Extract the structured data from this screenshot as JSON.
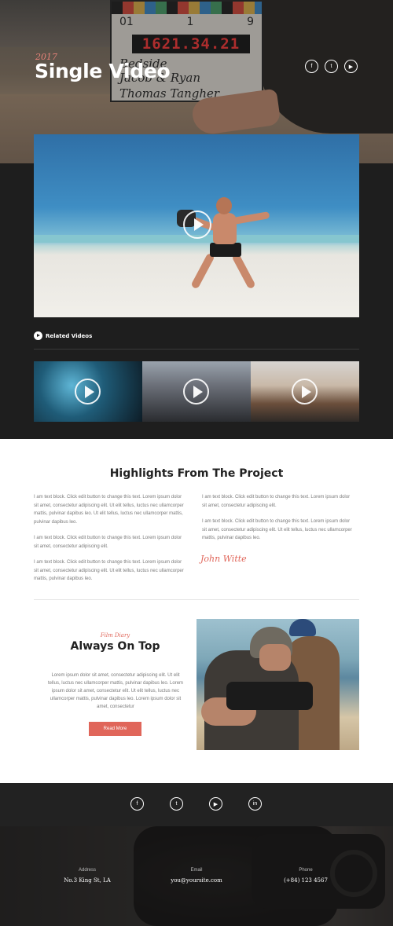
{
  "hero": {
    "year": "2017",
    "title": "Single Video",
    "clapper_timecode": "1621.34.21",
    "clapper_numbers": [
      "01",
      "1",
      "9"
    ],
    "clapper_lines": [
      "Bedside",
      "Jacob & Ryan",
      "Thomas Tangher"
    ],
    "social": [
      {
        "icon": "facebook-icon",
        "glyph": "f"
      },
      {
        "icon": "twitter-icon",
        "glyph": "t"
      },
      {
        "icon": "youtube-icon",
        "glyph": "▶"
      }
    ]
  },
  "related": {
    "label": "Related Videos"
  },
  "highlights": {
    "title": "Highlights From The Project",
    "left": [
      "I am text block. Click edit button to change this text. Lorem ipsum dolor sit amet, consectetur adipiscing elit. Ut elit tellus, luctus nec ullamcorper mattis, pulvinar dapibus leo. Ut elit tellus, luctus nec ullamcorper mattis, pulvinar dapibus leo.",
      "I am text block. Click edit button to change this text. Lorem ipsum dolor sit amet, consectetur adipiscing elit.",
      "I am text block. Click edit button to change this text. Lorem ipsum dolor sit amet, consectetur adipiscing elit. Ut elit tellus, luctus nec ullamcorper mattis, pulvinar dapibus leo."
    ],
    "right": [
      "I am text block. Click edit button to change this text. Lorem ipsum dolor sit amet, consectetur adipiscing elit.",
      "I am text block. Click edit button to change this text. Lorem ipsum dolor sit amet, consectetur adipiscing elit. Ut elit tellus, luctus nec ullamcorper mattis, pulvinar dapibus leo."
    ],
    "signature": "John Witte"
  },
  "feature": {
    "tag": "Film Diary",
    "title": "Always On Top",
    "body": "Lorem ipsum dolor sit amet, consectetur adipiscing elit. Ut elit tellus, luctus nec ullamcorper mattis, pulvinar dapibus leo.  Lorem ipsum dolor sit amet, consectetur elit. Ut elit tellus, luctus nec ullamcorper mattis, pulvinar dapibus leo. Lorem ipsum dolor sit amet, consectetur",
    "button": "Read More"
  },
  "footer": {
    "social": [
      {
        "icon": "facebook-icon",
        "glyph": "f"
      },
      {
        "icon": "twitter-icon",
        "glyph": "t"
      },
      {
        "icon": "youtube-icon",
        "glyph": "▶"
      },
      {
        "icon": "linkedin-icon",
        "glyph": "in"
      }
    ],
    "address_label": "Address",
    "address": "No.3 King St, LA",
    "email_label": "Email",
    "email": "you@yoursite.com",
    "phone_label": "Phone",
    "phone": "(+84) 123 4567"
  },
  "colors": {
    "accent": "#e0665a",
    "dark": "#1e1e1e"
  }
}
